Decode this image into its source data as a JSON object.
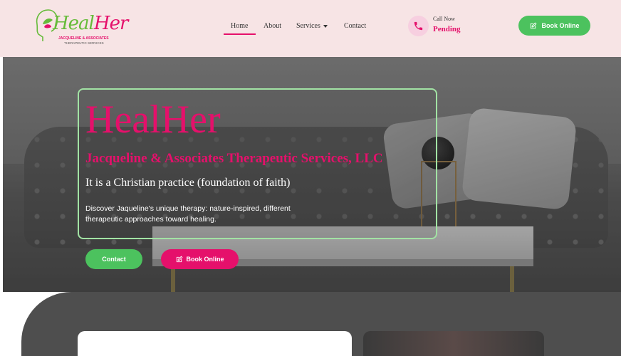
{
  "brand": {
    "logo_main_1": "Heal",
    "logo_main_2": "Her",
    "logo_sub": "JACQUELINE & ASSOCIATES",
    "logo_sub2": "THERAPEUTIC SERVICES"
  },
  "nav": {
    "items": [
      {
        "label": "Home",
        "active": true
      },
      {
        "label": "About"
      },
      {
        "label": "Services"
      },
      {
        "label": "Contact"
      }
    ]
  },
  "call": {
    "label": "Call Now",
    "value": "Pending"
  },
  "header_button": {
    "label": "Book Online",
    "icon": "edit-icon"
  },
  "hero": {
    "title": "HealHer",
    "subtitle": "Jacqueline & Associates Therapeutic Services, LLC",
    "tagline": "It is a Christian practice (foundation of faith)",
    "description": "Discover Jaqueline's unique therapy: nature-inspired, different therapeutic approaches toward healing.",
    "contact_button": "Contact",
    "book_button": "Book Online"
  },
  "colors": {
    "accent_pink": "#e5106b",
    "accent_green": "#4cc25e",
    "header_bg": "#f7e4e5"
  }
}
